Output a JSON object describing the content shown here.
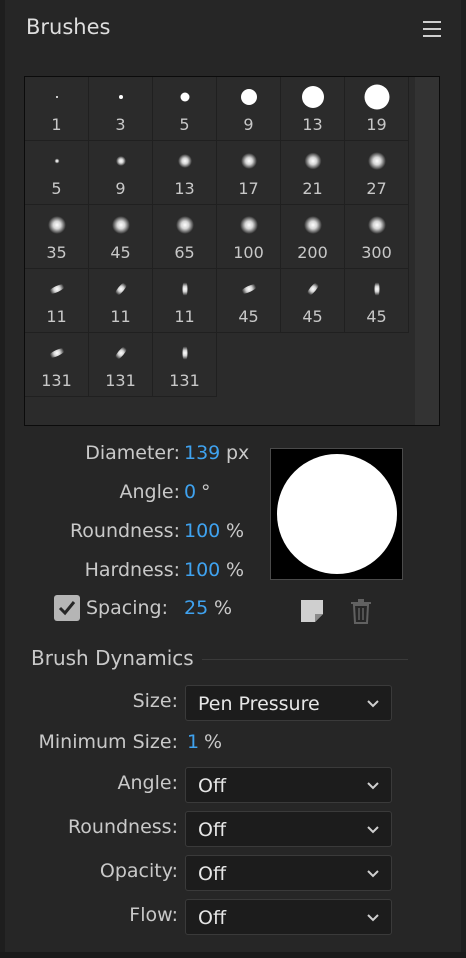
{
  "panel": {
    "title": "Brushes",
    "menu_icon": "hamburger-menu-icon"
  },
  "brush_grid": {
    "cells": [
      {
        "label": "1",
        "tip": "hard"
      },
      {
        "label": "3",
        "tip": "hard"
      },
      {
        "label": "5",
        "tip": "hard"
      },
      {
        "label": "9",
        "tip": "hard"
      },
      {
        "label": "13",
        "tip": "hard"
      },
      {
        "label": "19",
        "tip": "hard"
      },
      {
        "label": "5",
        "tip": "soft"
      },
      {
        "label": "9",
        "tip": "soft"
      },
      {
        "label": "13",
        "tip": "soft"
      },
      {
        "label": "17",
        "tip": "soft"
      },
      {
        "label": "21",
        "tip": "soft"
      },
      {
        "label": "27",
        "tip": "soft"
      },
      {
        "label": "35",
        "tip": "soft"
      },
      {
        "label": "45",
        "tip": "soft"
      },
      {
        "label": "65",
        "tip": "soft"
      },
      {
        "label": "100",
        "tip": "soft"
      },
      {
        "label": "200",
        "tip": "soft"
      },
      {
        "label": "300",
        "tip": "soft"
      },
      {
        "label": "11",
        "tip": "calligraphic"
      },
      {
        "label": "11",
        "tip": "calligraphic"
      },
      {
        "label": "11",
        "tip": "calligraphic"
      },
      {
        "label": "45",
        "tip": "calligraphic"
      },
      {
        "label": "45",
        "tip": "calligraphic"
      },
      {
        "label": "45",
        "tip": "calligraphic"
      },
      {
        "label": "131",
        "tip": "calligraphic"
      },
      {
        "label": "131",
        "tip": "calligraphic"
      },
      {
        "label": "131",
        "tip": "calligraphic"
      }
    ]
  },
  "properties": {
    "diameter": {
      "label": "Diameter:",
      "value": "139",
      "unit": "px"
    },
    "angle": {
      "label": "Angle:",
      "value": "0",
      "unit": "°"
    },
    "roundness": {
      "label": "Roundness:",
      "value": "100",
      "unit": "%"
    },
    "hardness": {
      "label": "Hardness:",
      "value": "100",
      "unit": "%"
    },
    "spacing": {
      "label": "Spacing:",
      "value": "25",
      "unit": "%",
      "checked": true
    }
  },
  "dynamics": {
    "title": "Brush Dynamics",
    "size": {
      "label": "Size:",
      "value": "Pen Pressure"
    },
    "minimum_size": {
      "label": "Minimum Size:",
      "value": "1",
      "unit": "%"
    },
    "angle": {
      "label": "Angle:",
      "value": "Off"
    },
    "roundness": {
      "label": "Roundness:",
      "value": "Off"
    },
    "opacity": {
      "label": "Opacity:",
      "value": "Off"
    },
    "flow": {
      "label": "Flow:",
      "value": "Off"
    }
  },
  "colors": {
    "accent": "#3fa2ef",
    "background": "#262626"
  }
}
